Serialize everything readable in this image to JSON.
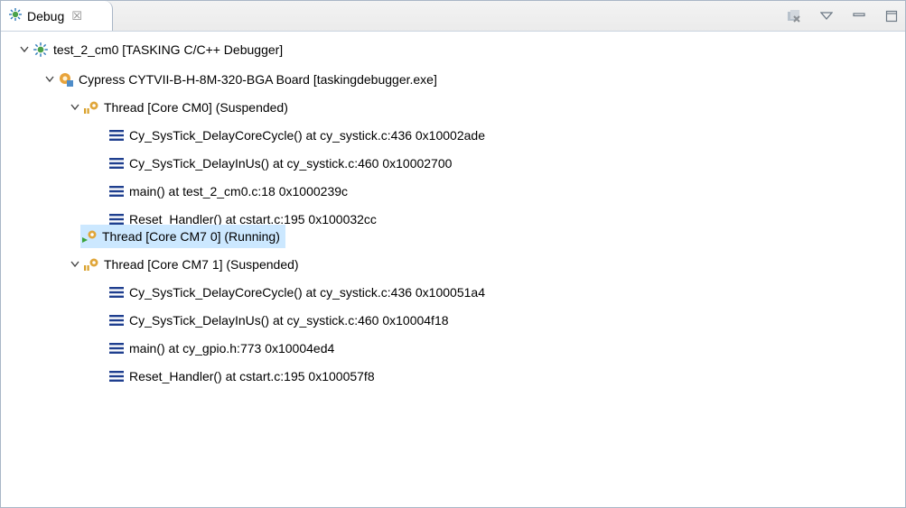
{
  "tab": {
    "title": "Debug",
    "close_glyph": "☒"
  },
  "toolbar": {
    "icons": [
      "remove-all-terminated-icon",
      "view-menu-icon",
      "minimize-icon",
      "maximize-icon"
    ]
  },
  "tree": {
    "launch": "test_2_cm0 [TASKING C/C++ Debugger]",
    "board": "Cypress CYTVII-B-H-8M-320-BGA Board [taskingdebugger.exe]",
    "threads": [
      {
        "label": "Thread [Core CM0] (Suspended)",
        "frames": [
          "Cy_SysTick_DelayCoreCycle() at cy_systick.c:436 0x10002ade",
          "Cy_SysTick_DelayInUs() at cy_systick.c:460 0x10002700",
          "main() at test_2_cm0.c:18 0x1000239c",
          "Reset_Handler() at cstart.c:195 0x100032cc"
        ]
      },
      {
        "label": "Thread [Core CM7 0] (Running)",
        "frames": []
      },
      {
        "label": "Thread [Core CM7 1] (Suspended)",
        "frames": [
          "Cy_SysTick_DelayCoreCycle() at cy_systick.c:436 0x100051a4",
          "Cy_SysTick_DelayInUs() at cy_systick.c:460 0x10004f18",
          "main() at cy_gpio.h:773 0x10004ed4",
          "Reset_Handler() at cstart.c:195 0x100057f8"
        ]
      }
    ]
  },
  "colors": {
    "selection": "#cce8ff",
    "frame_icon": "#1f3f8f",
    "border": "#a9b6c6"
  }
}
